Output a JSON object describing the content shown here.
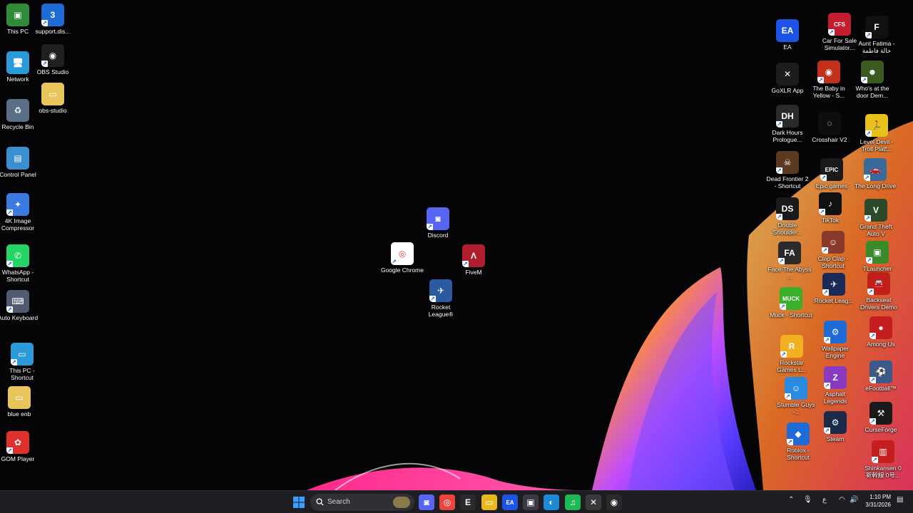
{
  "desktop": {
    "icons": [
      {
        "id": "this-pc",
        "label": "This PC",
        "color": "#2e8b3a",
        "glyph": "▣",
        "shortcut": false
      },
      {
        "id": "support-dis",
        "label": "support.dis...",
        "color": "#1e6bd6",
        "glyph": "3",
        "shortcut": true
      },
      {
        "id": "network",
        "label": "Network",
        "color": "#2a9ad8",
        "glyph": "🖥",
        "shortcut": false
      },
      {
        "id": "obs-studio",
        "label": "OBS Studio",
        "color": "#202020",
        "glyph": "◉",
        "shortcut": true
      },
      {
        "id": "obs-studio-folder",
        "label": "obs-studio",
        "color": "#e8c55a",
        "glyph": "▭",
        "shortcut": false
      },
      {
        "id": "recycle-bin",
        "label": "Recycle Bin",
        "color": "#5a6f86",
        "glyph": "♻",
        "shortcut": false
      },
      {
        "id": "control-panel",
        "label": "Control Panel",
        "color": "#3a8fd0",
        "glyph": "▤",
        "shortcut": false
      },
      {
        "id": "4k-image-compressor",
        "label": "4K Image Compressor",
        "color": "#3b7ae0",
        "glyph": "✦",
        "shortcut": true
      },
      {
        "id": "whatsapp",
        "label": "WhatsApp - Shortcut",
        "color": "#25d366",
        "glyph": "✆",
        "shortcut": true
      },
      {
        "id": "auto-keyboard",
        "label": "Auto Keyboard",
        "color": "#505a70",
        "glyph": "⌨",
        "shortcut": true
      },
      {
        "id": "this-pc-shortcut",
        "label": "This PC - Shortcut",
        "color": "#2a9ad8",
        "glyph": "▭",
        "shortcut": true
      },
      {
        "id": "blue-enb",
        "label": "blue enb",
        "color": "#e8c55a",
        "glyph": "▭",
        "shortcut": false
      },
      {
        "id": "gom-player",
        "label": "GOM Player",
        "color": "#e0312c",
        "glyph": "✿",
        "shortcut": true
      },
      {
        "id": "discord",
        "label": "Discord",
        "color": "#5865f2",
        "glyph": "◙",
        "shortcut": true
      },
      {
        "id": "google-chrome",
        "label": "Google Chrome",
        "color": "#ffffff",
        "glyph": "◎",
        "shortcut": true
      },
      {
        "id": "fivem",
        "label": "FiveM",
        "color": "#b01e2e",
        "glyph": "Λ",
        "shortcut": true
      },
      {
        "id": "rocket-league",
        "label": "Rocket League®",
        "color": "#2c5aa0",
        "glyph": "✈",
        "shortcut": true
      },
      {
        "id": "ea",
        "label": "EA",
        "color": "#1e54e6",
        "glyph": "EA",
        "shortcut": false
      },
      {
        "id": "car-for-sale",
        "label": "Car For Sale Simulator...",
        "color": "#c41e2e",
        "glyph": "CFS",
        "shortcut": true
      },
      {
        "id": "aunt-fatima",
        "label": "Aunt Fatima - خالة فاطمة",
        "color": "#111111",
        "glyph": "F",
        "shortcut": true
      },
      {
        "id": "goxlr",
        "label": "GoXLR App",
        "color": "#1c1c1c",
        "glyph": "✕",
        "shortcut": false
      },
      {
        "id": "baby-in-yellow",
        "label": "The Baby in Yellow - S...",
        "color": "#c0301a",
        "glyph": "◉",
        "shortcut": true
      },
      {
        "id": "whos-at-the-door",
        "label": "Who's at the door Dem...",
        "color": "#3a5a20",
        "glyph": "☻",
        "shortcut": true
      },
      {
        "id": "dark-hours",
        "label": "Dark Hours Prologue...",
        "color": "#2a2a2a",
        "glyph": "DH",
        "shortcut": true
      },
      {
        "id": "crosshair-v2",
        "label": "Crosshair V2",
        "color": "#0e0e0e",
        "glyph": "◌",
        "shortcut": false
      },
      {
        "id": "level-devil",
        "label": "Level Devil - Troll Platf...",
        "color": "#e8c21a",
        "glyph": "🏃",
        "shortcut": true
      },
      {
        "id": "dead-frontier",
        "label": "Dead Frontier 2 - Shortcut",
        "color": "#5a3a20",
        "glyph": "☠",
        "shortcut": true
      },
      {
        "id": "epic-games",
        "label": "Epic games",
        "color": "#1a1a1a",
        "glyph": "EPIC",
        "shortcut": true
      },
      {
        "id": "the-long-drive",
        "label": "The Long Drive",
        "color": "#3a6a9a",
        "glyph": "🚗",
        "shortcut": true
      },
      {
        "id": "double-shoulder",
        "label": "Double Shoulder...",
        "color": "#1a1a1a",
        "glyph": "DS",
        "shortcut": true
      },
      {
        "id": "tiktok",
        "label": "TikTok",
        "color": "#111111",
        "glyph": "♪",
        "shortcut": true
      },
      {
        "id": "gta-v",
        "label": "Grand Theft Auto V",
        "color": "#2a4a2a",
        "glyph": "V",
        "shortcut": true
      },
      {
        "id": "face-the-abyss",
        "label": "Face The Abyss ...",
        "color": "#2a2a2a",
        "glyph": "FA",
        "shortcut": true
      },
      {
        "id": "clap-clap",
        "label": "Clap Clap - Shortcut",
        "color": "#8a3a2a",
        "glyph": "☺",
        "shortcut": true
      },
      {
        "id": "tlauncher",
        "label": "TLauncher",
        "color": "#3a8a2a",
        "glyph": "▣",
        "shortcut": true
      },
      {
        "id": "muck",
        "label": "Muck - Shortcut",
        "color": "#3ab02a",
        "glyph": "MUCK",
        "shortcut": true
      },
      {
        "id": "rocket-league-2",
        "label": "Rocket Leag...",
        "color": "#1a2a5a",
        "glyph": "✈",
        "shortcut": true
      },
      {
        "id": "backseat-drivers",
        "label": "Backseat Drivers Demo",
        "color": "#c0201a",
        "glyph": "🚘",
        "shortcut": true
      },
      {
        "id": "rockstar-games",
        "label": "Rockstar Games L...",
        "color": "#f0b020",
        "glyph": "R",
        "shortcut": true
      },
      {
        "id": "wallpaper-engine",
        "label": "Wallpaper Engine",
        "color": "#1e6ad6",
        "glyph": "⚙",
        "shortcut": true
      },
      {
        "id": "among-us",
        "label": "Among Us",
        "color": "#c41e1e",
        "glyph": "●",
        "shortcut": true
      },
      {
        "id": "stumble-guys",
        "label": "Stumble Guys -...",
        "color": "#2a8ae0",
        "glyph": "☺",
        "shortcut": true
      },
      {
        "id": "asphalt-legends",
        "label": "Asphalt Legends",
        "color": "#8a3ac0",
        "glyph": "Z",
        "shortcut": true
      },
      {
        "id": "efootball",
        "label": "eFootball™",
        "color": "#3a5a8a",
        "glyph": "⚽",
        "shortcut": true
      },
      {
        "id": "roblox",
        "label": "Roblox - Shortcut",
        "color": "#1e6ad6",
        "glyph": "◆",
        "shortcut": true
      },
      {
        "id": "steam",
        "label": "Steam",
        "color": "#1a2a4a",
        "glyph": "⚙",
        "shortcut": true
      },
      {
        "id": "curseforge",
        "label": "CurseForge",
        "color": "#1a1a1a",
        "glyph": "⚒",
        "shortcut": true
      },
      {
        "id": "shinkansen",
        "label": "Shinkansen 0 新幹線 0号...",
        "color": "#c41e1e",
        "glyph": "▥",
        "shortcut": true
      }
    ]
  },
  "taskbar": {
    "search_label": "Search",
    "apps": [
      {
        "id": "discord",
        "glyph": "◙",
        "color": "#5865f2"
      },
      {
        "id": "chrome",
        "glyph": "◎",
        "color": "#e8453c"
      },
      {
        "id": "epic-games",
        "glyph": "E",
        "color": "#2a2a2a"
      },
      {
        "id": "file-explorer",
        "glyph": "▭",
        "color": "#e8b820"
      },
      {
        "id": "ea",
        "glyph": "EA",
        "color": "#1e54e6"
      },
      {
        "id": "terminal",
        "glyph": "▣",
        "color": "#3a3a44"
      },
      {
        "id": "edge",
        "glyph": "◐",
        "color": "#1e8ad6"
      },
      {
        "id": "spotify",
        "glyph": "♫",
        "color": "#1db954"
      },
      {
        "id": "goxlr",
        "glyph": "✕",
        "color": "#3a3a3a"
      },
      {
        "id": "obs",
        "glyph": "◉",
        "color": "#2a2a2a"
      }
    ],
    "tray": {
      "ime": "ع",
      "time": "1:10 PM",
      "date": "3/31/2026"
    }
  }
}
